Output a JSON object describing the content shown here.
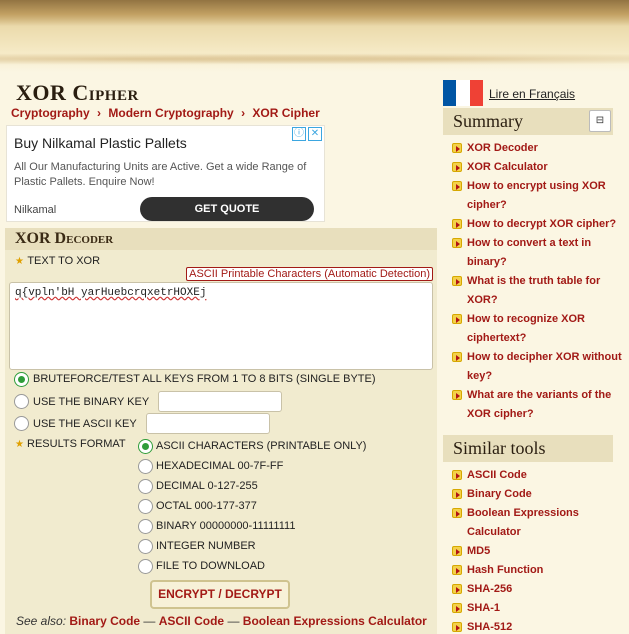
{
  "page": {
    "title": "XOR Cipher",
    "breadcrumb": [
      "Cryptography",
      "Modern Cryptography",
      "XOR Cipher"
    ],
    "breadcrumb_sep": "›"
  },
  "ad": {
    "title": "Buy Nilkamal Plastic Pallets",
    "body": "All Our Manufacturing Units are Active. Get a wide Range of Plastic Pallets. Enquire Now!",
    "advertiser": "Nilkamal",
    "cta": "GET QUOTE",
    "info_icon": "ⓘ",
    "close_icon": "✕"
  },
  "decoder": {
    "title": "XOR Decoder",
    "text_label": "TEXT TO XOR",
    "ascii_badge": "ASCII Printable Characters (Automatic Detection)",
    "text_value": "q{vpln'bH yarHuebcrqxetrHOXEj",
    "option_bruteforce": "BRUTEFORCE/TEST ALL KEYS FROM 1 TO 8 BITS (SINGLE BYTE)",
    "option_binary_key": "USE THE BINARY KEY",
    "option_ascii_key": "USE THE ASCII KEY",
    "results_label": "RESULTS FORMAT",
    "formats": [
      "ASCII CHARACTERS (PRINTABLE ONLY)",
      "HEXADECIMAL 00-7F-FF",
      "DECIMAL 0-127-255",
      "OCTAL 000-177-377",
      "BINARY 00000000-11111111",
      "INTEGER NUMBER",
      "FILE TO DOWNLOAD"
    ],
    "submit": "ENCRYPT / DECRYPT",
    "see_also_label": "See also:",
    "see_also": [
      "Binary Code",
      "ASCII Code",
      "Boolean Expressions Calculator"
    ],
    "see_also_sep": "—"
  },
  "sidebar": {
    "lang_link": "Lire en Français",
    "flag_colors": [
      "#0055a4",
      "#ffffff",
      "#ef4135"
    ],
    "summary_title": "Summary",
    "collapse_icon": "⊟",
    "summary_items": [
      "XOR Decoder",
      "XOR Calculator",
      "How to encrypt using XOR cipher?",
      "How to decrypt XOR cipher?",
      "How to convert a text in binary?",
      "What is the truth table for XOR?",
      "How to recognize XOR ciphertext?",
      "How to decipher XOR without key?",
      "What are the variants of the XOR cipher?"
    ],
    "similar_title": "Similar tools",
    "similar_items": [
      "ASCII Code",
      "Binary Code",
      "Boolean Expressions Calculator",
      "MD5",
      "Hash Function",
      "SHA-256",
      "SHA-1",
      "SHA-512"
    ]
  },
  "colors": {
    "link_red": "#a21a16",
    "parchment": "#fbf6e3",
    "panel": "#f1ebcf",
    "radio_green": "#2f9d3a"
  }
}
